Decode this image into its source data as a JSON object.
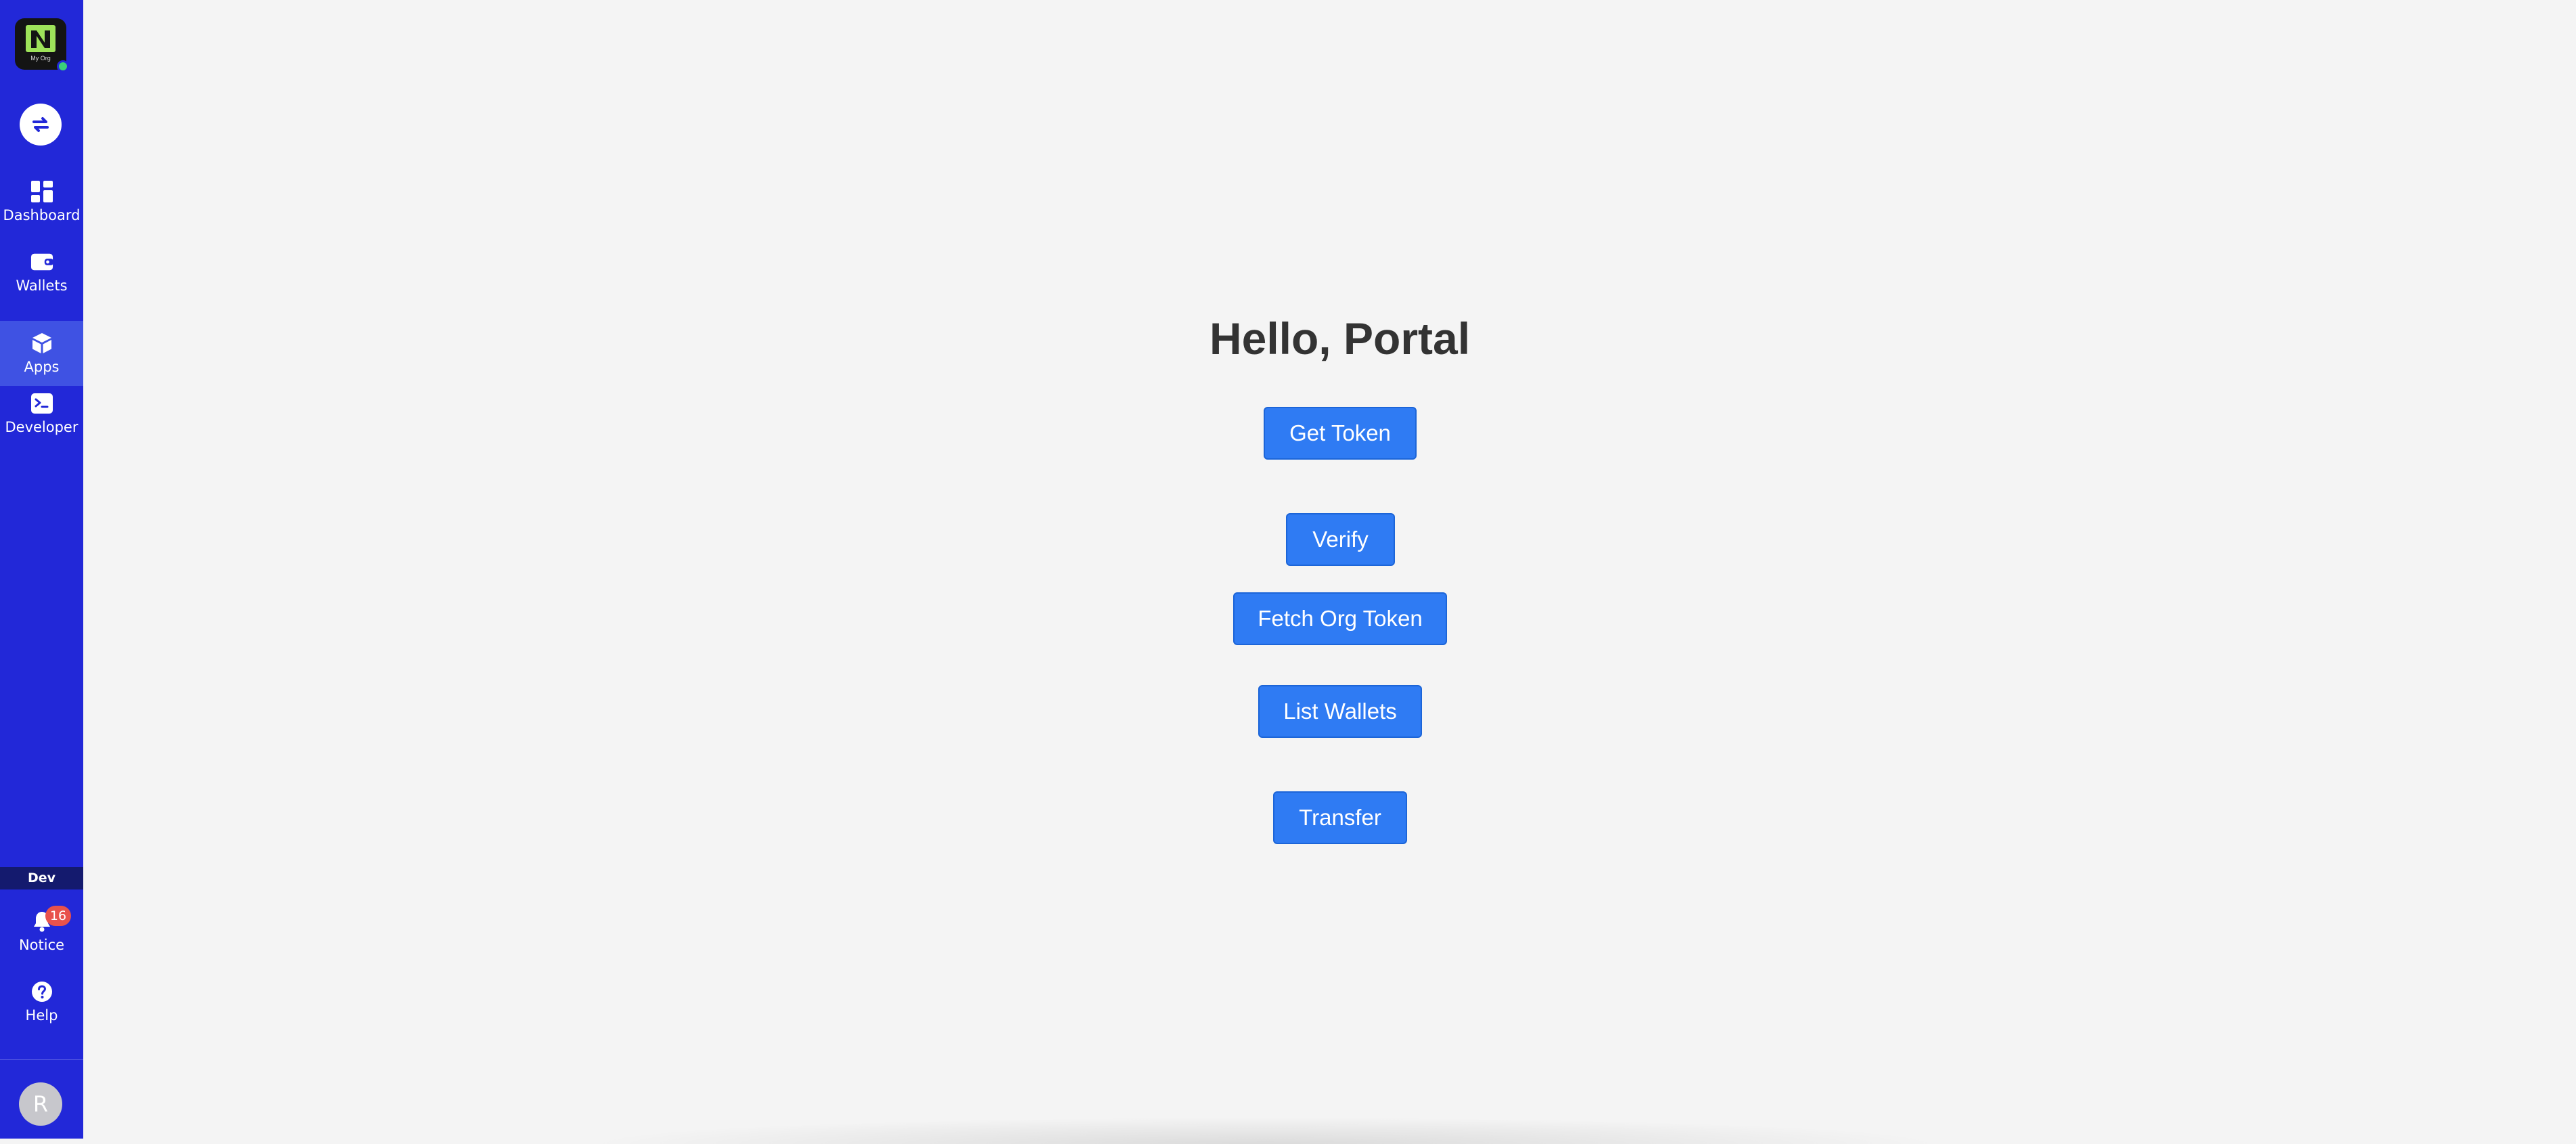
{
  "sidebar": {
    "logo_text": "My Org",
    "switch_icon": "swap-arrows-icon",
    "items": [
      {
        "label": "Dashboard",
        "icon": "dashboard-grid-icon",
        "active": false
      },
      {
        "label": "Wallets",
        "icon": "wallet-icon",
        "active": false
      },
      {
        "label": "Apps",
        "icon": "cube-icon",
        "active": true
      },
      {
        "label": "Developer",
        "icon": "terminal-icon",
        "active": false
      }
    ],
    "environment": "Dev",
    "notice": {
      "label": "Notice",
      "count": "16",
      "icon": "bell-icon"
    },
    "help": {
      "label": "Help",
      "icon": "help-circle-icon"
    },
    "avatar_initial": "R"
  },
  "main": {
    "heading": "Hello, Portal",
    "buttons": {
      "get_token": "Get Token",
      "verify": "Verify",
      "fetch_org_token": "Fetch Org Token",
      "list_wallets": "List Wallets",
      "transfer": "Transfer"
    }
  },
  "colors": {
    "sidebar_bg": "#2228d8",
    "sidebar_active": "#3f52e3",
    "button_bg": "#2f7bf3",
    "page_bg": "#f4f4f4",
    "badge": "#e8524c"
  }
}
